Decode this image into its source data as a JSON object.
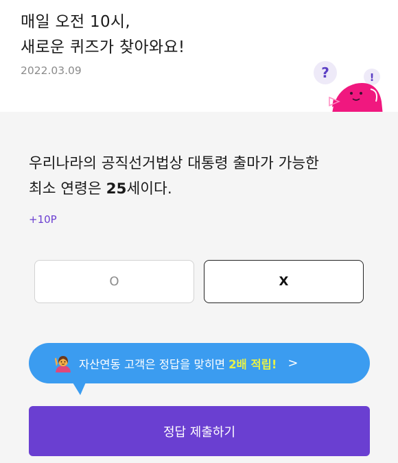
{
  "header": {
    "title_line1": "매일 오전 10시,",
    "title_line2": "새로운 퀴즈가 찾아와요!",
    "date": "2022.03.09",
    "mascot_icon": "pink-blob-mascot-icon",
    "mascot_marks": [
      "?",
      "!"
    ]
  },
  "quiz": {
    "question_line1": "우리나라의 공직선거법상 대통령 출마가 가능한",
    "question_line2_prefix": "최소 연령은 ",
    "question_line2_bold": "25",
    "question_line2_suffix": "세이다.",
    "points": "+10P",
    "options": [
      "O",
      "X"
    ],
    "selected": "X"
  },
  "tip": {
    "icon": "person-raising-hand-emoji-icon",
    "text": "자산연동 고객은 정답을 맞히면",
    "highlight": "2배 적립!",
    "chevron": ">",
    "bg_color": "#3b9cf0",
    "highlight_color": "#e6f14a"
  },
  "submit": {
    "label": "정답 제출하기",
    "color": "#6a3fd1"
  }
}
